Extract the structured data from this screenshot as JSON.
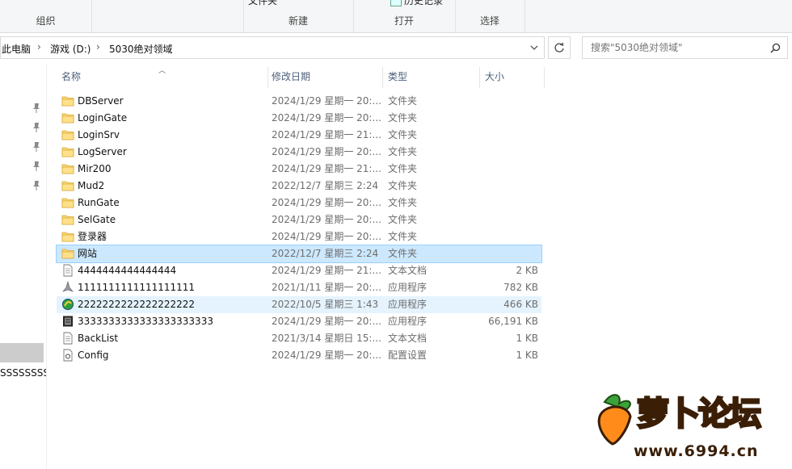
{
  "ribbon": {
    "groups": [
      {
        "label": "组织"
      },
      {
        "label": "新建",
        "top_item": "文件夹"
      },
      {
        "label": "打开",
        "top_item": "历史记录"
      },
      {
        "label": "选择"
      }
    ]
  },
  "address": {
    "crumbs": [
      "此电脑",
      "游戏 (D:)",
      "5030绝对领域"
    ],
    "search_placeholder": "搜索\"5030绝对领域\""
  },
  "nav": {
    "partial_label": "SSSSSSSSSS"
  },
  "columns": {
    "name": "名称",
    "date": "修改日期",
    "type": "类型",
    "size": "大小"
  },
  "files": [
    {
      "name": "DBServer",
      "date": "2024/1/29 星期一 20:...",
      "type": "文件夹",
      "size": "",
      "icon": "folder-icon"
    },
    {
      "name": "LoginGate",
      "date": "2024/1/29 星期一 20:...",
      "type": "文件夹",
      "size": "",
      "icon": "folder-icon"
    },
    {
      "name": "LoginSrv",
      "date": "2024/1/29 星期一 21:...",
      "type": "文件夹",
      "size": "",
      "icon": "folder-icon"
    },
    {
      "name": "LogServer",
      "date": "2024/1/29 星期一 20:...",
      "type": "文件夹",
      "size": "",
      "icon": "folder-icon"
    },
    {
      "name": "Mir200",
      "date": "2024/1/29 星期一 21:...",
      "type": "文件夹",
      "size": "",
      "icon": "folder-icon"
    },
    {
      "name": "Mud2",
      "date": "2022/12/7 星期三 2:24",
      "type": "文件夹",
      "size": "",
      "icon": "folder-icon"
    },
    {
      "name": "RunGate",
      "date": "2024/1/29 星期一 20:...",
      "type": "文件夹",
      "size": "",
      "icon": "folder-icon"
    },
    {
      "name": "SelGate",
      "date": "2024/1/29 星期一 20:...",
      "type": "文件夹",
      "size": "",
      "icon": "folder-icon"
    },
    {
      "name": "登录器",
      "date": "2024/1/29 星期一 20:...",
      "type": "文件夹",
      "size": "",
      "icon": "folder-icon"
    },
    {
      "name": "网站",
      "date": "2022/12/7 星期三 2:24",
      "type": "文件夹",
      "size": "",
      "icon": "folder-icon"
    },
    {
      "name": "4444444444444444",
      "date": "2024/1/29 星期一 21:...",
      "type": "文本文档",
      "size": "2 KB",
      "icon": "text-file-icon"
    },
    {
      "name": "1111111111111111111",
      "date": "2021/1/11 星期一 20:...",
      "type": "应用程序",
      "size": "782 KB",
      "icon": "app-icon"
    },
    {
      "name": "2222222222222222222",
      "date": "2022/10/5 星期三 1:43",
      "type": "应用程序",
      "size": "466 KB",
      "icon": "app-icon"
    },
    {
      "name": "3333333333333333333333",
      "date": "2024/1/29 星期一 20:...",
      "type": "应用程序",
      "size": "66,191 KB",
      "icon": "app-icon"
    },
    {
      "name": "BackList",
      "date": "2021/3/14 星期日 15:...",
      "type": "文本文档",
      "size": "1 KB",
      "icon": "text-file-icon"
    },
    {
      "name": "Config",
      "date": "2024/1/29 星期一 20:...",
      "type": "配置设置",
      "size": "1 KB",
      "icon": "config-file-icon"
    }
  ],
  "watermark": {
    "text": "萝卜论坛",
    "url": "www.6994.cn"
  }
}
